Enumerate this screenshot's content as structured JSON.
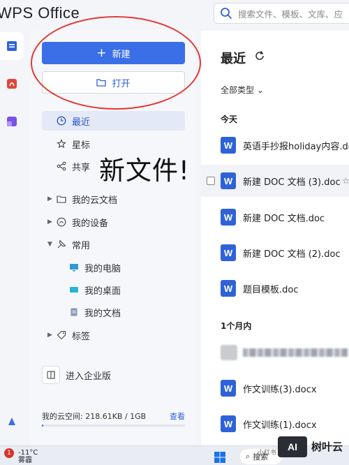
{
  "app": {
    "title": "WPS Office"
  },
  "search": {
    "placeholder": "搜索文件、模板、文库、应"
  },
  "sidebar": {
    "new_label": "新建",
    "open_label": "打开",
    "nav": [
      {
        "label": "最近",
        "icon": "clock-icon"
      },
      {
        "label": "星标",
        "icon": "star-icon"
      },
      {
        "label": "共享",
        "icon": "share-icon"
      },
      {
        "label": "我的云文档",
        "icon": "folder-icon"
      },
      {
        "label": "我的设备",
        "icon": "cloud-icon"
      },
      {
        "label": "常用",
        "icon": "pin-icon"
      },
      {
        "label": "我的电脑",
        "icon": "monitor-icon"
      },
      {
        "label": "我的桌面",
        "icon": "desktop-icon"
      },
      {
        "label": "我的文档",
        "icon": "document-icon"
      },
      {
        "label": "标签",
        "icon": "tag-icon"
      }
    ],
    "enterprise_label": "进入企业版",
    "cloud_storage": {
      "label": "我的云空间: 218.61KB / 1GB",
      "view_label": "查看",
      "used_fraction": 0.0002
    }
  },
  "annotation": "新文件!",
  "main": {
    "title": "最近",
    "filter_label": "全部类型",
    "groups": {
      "today": "今天",
      "month": "1个月内"
    },
    "files_today": [
      {
        "name": "英语手抄报holiday内容.doc"
      },
      {
        "name": "新建 DOC 文档 (3).doc"
      },
      {
        "name": "新建 DOC 文档.doc"
      },
      {
        "name": "新建 DOC 文档 (2).doc"
      },
      {
        "name": "题目模板.doc"
      }
    ],
    "files_month": [
      {
        "name": "作文训练(3).docx"
      },
      {
        "name": "作文训练(1).docx"
      }
    ]
  },
  "taskbar": {
    "badge": "1",
    "temperature": "-11°C",
    "weather": "雾霾",
    "search_label": "搜索"
  },
  "watermark": {
    "logo": "AI",
    "name": "树叶云",
    "source": "小红书"
  },
  "colors": {
    "accent": "#3b6fe8",
    "annotation_circle": "#e23a36",
    "word_icon": "#2f62d8"
  }
}
